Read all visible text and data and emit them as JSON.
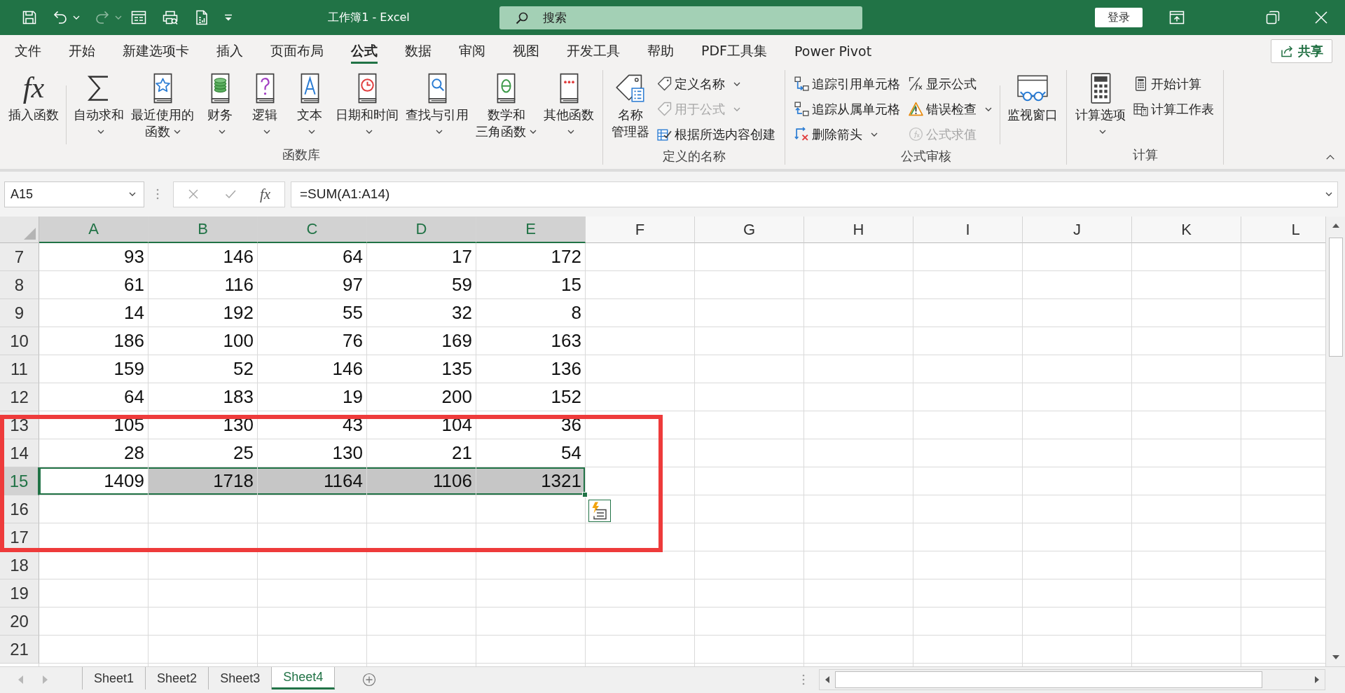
{
  "window": {
    "title": "工作簿1 - Excel",
    "search": {
      "placeholder": "搜索"
    },
    "login_button": "登录"
  },
  "menu_tabs": [
    {
      "label": "文件",
      "selected": false
    },
    {
      "label": "开始",
      "selected": false
    },
    {
      "label": "新建选项卡",
      "selected": false
    },
    {
      "label": "插入",
      "selected": false
    },
    {
      "label": "页面布局",
      "selected": false
    },
    {
      "label": "公式",
      "selected": true
    },
    {
      "label": "数据",
      "selected": false
    },
    {
      "label": "审阅",
      "selected": false
    },
    {
      "label": "视图",
      "selected": false
    },
    {
      "label": "开发工具",
      "selected": false
    },
    {
      "label": "帮助",
      "selected": false
    },
    {
      "label": "PDF工具集",
      "selected": false
    },
    {
      "label": "Power Pivot",
      "selected": false
    }
  ],
  "share_button": "共享",
  "ribbon": [
    {
      "label": "函数库",
      "controls": [
        {
          "kind": "large",
          "glyph": "fx",
          "lines": [
            "插入函数"
          ],
          "dropdown": false,
          "disabled": false
        },
        {
          "kind": "separator"
        },
        {
          "kind": "large",
          "lines": [
            "自动求和"
          ],
          "dropdown": true,
          "disabled": false
        },
        {
          "kind": "large",
          "lines": [
            "最近使用的",
            "函数"
          ],
          "dropdown": true,
          "disabled": false
        },
        {
          "kind": "large",
          "lines": [
            "财务"
          ],
          "dropdown": true,
          "disabled": false
        },
        {
          "kind": "large",
          "lines": [
            "逻辑"
          ],
          "dropdown": true,
          "disabled": false
        },
        {
          "kind": "large",
          "lines": [
            "文本"
          ],
          "dropdown": true,
          "disabled": false
        },
        {
          "kind": "large",
          "lines": [
            "日期和时间"
          ],
          "dropdown": true,
          "disabled": false
        },
        {
          "kind": "large",
          "lines": [
            "查找与引用"
          ],
          "dropdown": true,
          "disabled": false
        },
        {
          "kind": "large",
          "lines": [
            "数学和",
            "三角函数"
          ],
          "dropdown": true,
          "disabled": false
        },
        {
          "kind": "large",
          "lines": [
            "其他函数"
          ],
          "dropdown": true,
          "disabled": false
        }
      ]
    },
    {
      "label": "定义的名称",
      "controls": [
        {
          "kind": "large",
          "lines": [
            "名称",
            "管理器"
          ],
          "dropdown": false,
          "disabled": false
        },
        {
          "kind": "stack",
          "items": [
            {
              "label": "定义名称",
              "dropdown": true,
              "disabled": false
            },
            {
              "label": "用于公式",
              "dropdown": true,
              "disabled": true
            },
            {
              "label": "根据所选内容创建",
              "dropdown": false,
              "disabled": false
            }
          ]
        }
      ]
    },
    {
      "label": "公式审核",
      "controls": [
        {
          "kind": "stack",
          "items": [
            {
              "label": "追踪引用单元格",
              "dropdown": false,
              "disabled": false
            },
            {
              "label": "追踪从属单元格",
              "dropdown": false,
              "disabled": false
            },
            {
              "label": "删除箭头",
              "dropdown": true,
              "disabled": false
            }
          ]
        },
        {
          "kind": "stack",
          "items": [
            {
              "label": "显示公式",
              "dropdown": false,
              "disabled": false
            },
            {
              "label": "错误检查",
              "dropdown": true,
              "disabled": false
            },
            {
              "label": "公式求值",
              "dropdown": false,
              "disabled": true
            }
          ]
        },
        {
          "kind": "separator"
        },
        {
          "kind": "large",
          "lines": [
            "监视窗口"
          ],
          "dropdown": false,
          "disabled": false
        }
      ]
    },
    {
      "label": "计算",
      "controls": [
        {
          "kind": "large",
          "lines": [
            "计算选项"
          ],
          "dropdown": true,
          "disabled": false
        },
        {
          "kind": "stack",
          "items": [
            {
              "label": "开始计算",
              "dropdown": false,
              "disabled": false
            },
            {
              "label": "计算工作表",
              "dropdown": false,
              "disabled": false
            }
          ]
        }
      ]
    }
  ],
  "formula_bar": {
    "name_box": "A15",
    "function_glyph": "fx",
    "formula": "=SUM(A1:A14)"
  },
  "sheet": {
    "columns": [
      {
        "label": "A",
        "selected": true
      },
      {
        "label": "B",
        "selected": true
      },
      {
        "label": "C",
        "selected": true
      },
      {
        "label": "D",
        "selected": true
      },
      {
        "label": "E",
        "selected": true
      },
      {
        "label": "F",
        "selected": false
      },
      {
        "label": "G",
        "selected": false
      },
      {
        "label": "H",
        "selected": false
      },
      {
        "label": "I",
        "selected": false
      },
      {
        "label": "J",
        "selected": false
      },
      {
        "label": "K",
        "selected": false
      },
      {
        "label": "L",
        "selected": false
      }
    ],
    "rows": [
      {
        "number": "7",
        "selected": false,
        "cells": [
          {
            "value": "93",
            "selected": false,
            "active": false
          },
          {
            "value": "146",
            "selected": false,
            "active": false
          },
          {
            "value": "64",
            "selected": false,
            "active": false
          },
          {
            "value": "17",
            "selected": false,
            "active": false
          },
          {
            "value": "172",
            "selected": false,
            "active": false
          }
        ]
      },
      {
        "number": "8",
        "selected": false,
        "cells": [
          {
            "value": "61",
            "selected": false,
            "active": false
          },
          {
            "value": "116",
            "selected": false,
            "active": false
          },
          {
            "value": "97",
            "selected": false,
            "active": false
          },
          {
            "value": "59",
            "selected": false,
            "active": false
          },
          {
            "value": "15",
            "selected": false,
            "active": false
          }
        ]
      },
      {
        "number": "9",
        "selected": false,
        "cells": [
          {
            "value": "14",
            "selected": false,
            "active": false
          },
          {
            "value": "192",
            "selected": false,
            "active": false
          },
          {
            "value": "55",
            "selected": false,
            "active": false
          },
          {
            "value": "32",
            "selected": false,
            "active": false
          },
          {
            "value": "8",
            "selected": false,
            "active": false
          }
        ]
      },
      {
        "number": "10",
        "selected": false,
        "cells": [
          {
            "value": "186",
            "selected": false,
            "active": false
          },
          {
            "value": "100",
            "selected": false,
            "active": false
          },
          {
            "value": "76",
            "selected": false,
            "active": false
          },
          {
            "value": "169",
            "selected": false,
            "active": false
          },
          {
            "value": "163",
            "selected": false,
            "active": false
          }
        ]
      },
      {
        "number": "11",
        "selected": false,
        "cells": [
          {
            "value": "159",
            "selected": false,
            "active": false
          },
          {
            "value": "52",
            "selected": false,
            "active": false
          },
          {
            "value": "146",
            "selected": false,
            "active": false
          },
          {
            "value": "135",
            "selected": false,
            "active": false
          },
          {
            "value": "136",
            "selected": false,
            "active": false
          }
        ]
      },
      {
        "number": "12",
        "selected": false,
        "cells": [
          {
            "value": "64",
            "selected": false,
            "active": false
          },
          {
            "value": "183",
            "selected": false,
            "active": false
          },
          {
            "value": "19",
            "selected": false,
            "active": false
          },
          {
            "value": "200",
            "selected": false,
            "active": false
          },
          {
            "value": "152",
            "selected": false,
            "active": false
          }
        ]
      },
      {
        "number": "13",
        "selected": false,
        "cells": [
          {
            "value": "105",
            "selected": false,
            "active": false
          },
          {
            "value": "130",
            "selected": false,
            "active": false
          },
          {
            "value": "43",
            "selected": false,
            "active": false
          },
          {
            "value": "104",
            "selected": false,
            "active": false
          },
          {
            "value": "36",
            "selected": false,
            "active": false
          }
        ]
      },
      {
        "number": "14",
        "selected": false,
        "cells": [
          {
            "value": "28",
            "selected": false,
            "active": false
          },
          {
            "value": "25",
            "selected": false,
            "active": false
          },
          {
            "value": "130",
            "selected": false,
            "active": false
          },
          {
            "value": "21",
            "selected": false,
            "active": false
          },
          {
            "value": "54",
            "selected": false,
            "active": false
          }
        ]
      },
      {
        "number": "15",
        "selected": true,
        "cells": [
          {
            "value": "1409",
            "selected": true,
            "active": true
          },
          {
            "value": "1718",
            "selected": true,
            "active": false
          },
          {
            "value": "1164",
            "selected": true,
            "active": false
          },
          {
            "value": "1106",
            "selected": true,
            "active": false
          },
          {
            "value": "1321",
            "selected": true,
            "active": false
          }
        ]
      },
      {
        "number": "16",
        "selected": false,
        "cells": []
      },
      {
        "number": "17",
        "selected": false,
        "cells": []
      },
      {
        "number": "18",
        "selected": false,
        "cells": []
      },
      {
        "number": "19",
        "selected": false,
        "cells": []
      },
      {
        "number": "20",
        "selected": false,
        "cells": []
      },
      {
        "number": "21",
        "selected": false,
        "cells": []
      }
    ]
  },
  "sheet_tabs": [
    {
      "label": "Sheet1",
      "selected": false
    },
    {
      "label": "Sheet2",
      "selected": false
    },
    {
      "label": "Sheet3",
      "selected": false
    },
    {
      "label": "Sheet4",
      "selected": true
    }
  ]
}
